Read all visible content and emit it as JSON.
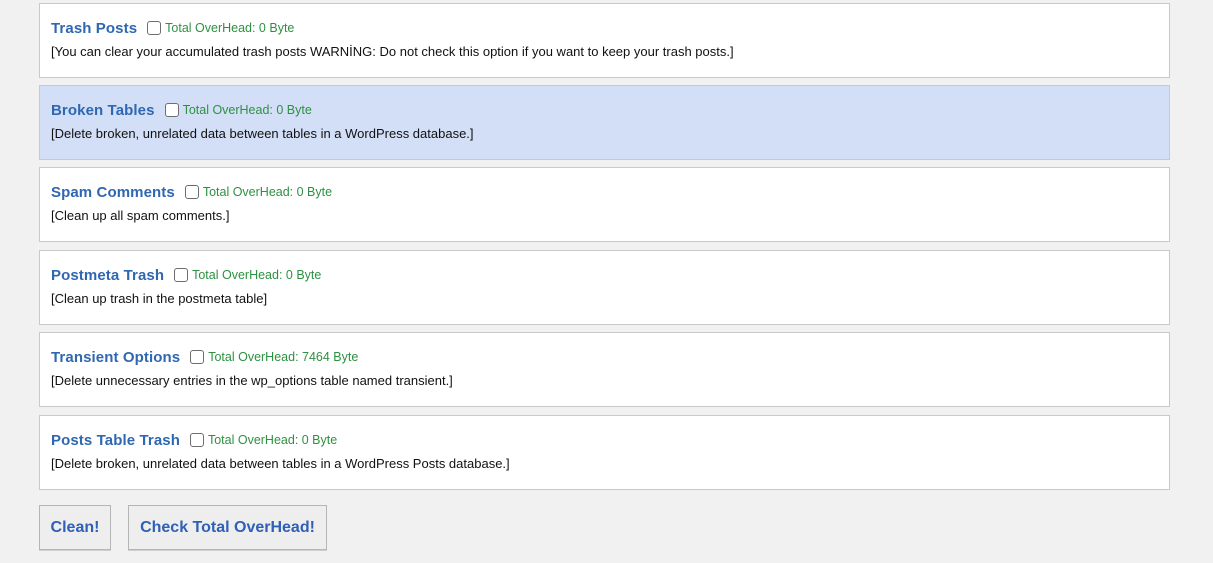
{
  "items": [
    {
      "title": "Trash Posts",
      "overhead": "Total OverHead: 0 Byte",
      "description": "[You can clear your accumulated trash posts WARNİNG: Do not check this option if you want to keep your trash posts.]"
    },
    {
      "title": "Broken Tables",
      "overhead": "Total OverHead: 0 Byte",
      "description": "[Delete broken, unrelated data between tables in a WordPress database.]"
    },
    {
      "title": "Spam Comments",
      "overhead": "Total OverHead: 0 Byte",
      "description": "[Clean up all spam comments.]"
    },
    {
      "title": "Postmeta Trash",
      "overhead": "Total OverHead: 0 Byte",
      "description": "[Clean up trash in the postmeta table]"
    },
    {
      "title": "Transient Options",
      "overhead": "Total OverHead: 7464 Byte",
      "description": "[Delete unnecessary entries in the wp_options table named transient.]"
    },
    {
      "title": "Posts Table Trash",
      "overhead": "Total OverHead: 0 Byte",
      "description": "[Delete broken, unrelated data between tables in a WordPress Posts database.]"
    }
  ],
  "buttons": {
    "clean_label": "Clean!",
    "check_label": "Check Total OverHead!"
  },
  "colors": {
    "title": "#2f67b1",
    "overhead": "#2e9142",
    "highlight_row": "#d2dff7",
    "button_text": "#2f5fb7"
  }
}
